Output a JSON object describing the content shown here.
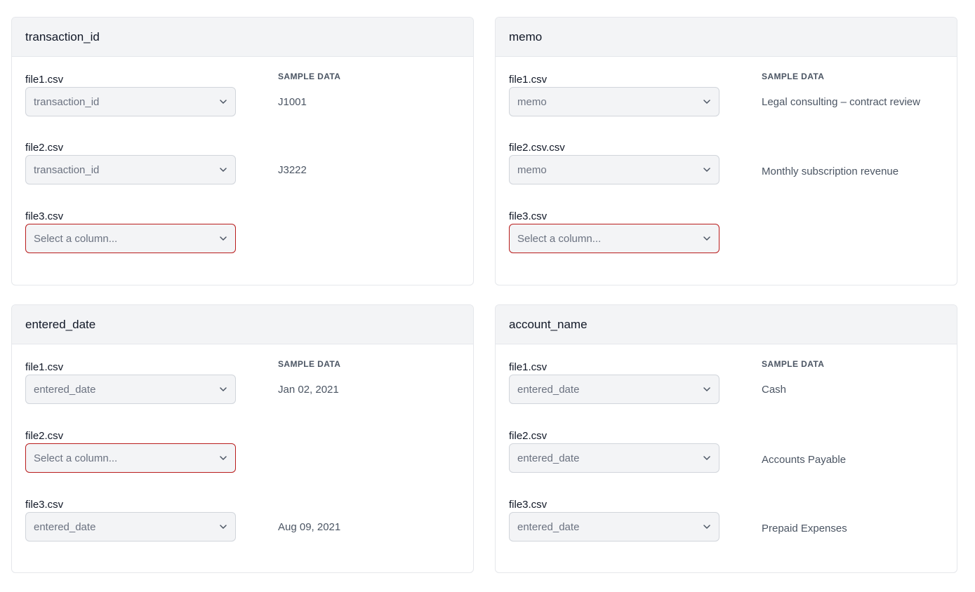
{
  "cards": [
    {
      "title": "transaction_id",
      "sample_header": "SAMPLE DATA",
      "rows": [
        {
          "file": "file1.csv",
          "selected": "transaction_id",
          "sample": "J1001"
        },
        {
          "file": "file2.csv",
          "selected": "transaction_id",
          "sample": "J3222"
        },
        {
          "file": "file3.csv",
          "selected": "Select a column...",
          "sample": ""
        }
      ]
    },
    {
      "title": "memo",
      "sample_header": "SAMPLE DATA",
      "rows": [
        {
          "file": "file1.csv",
          "selected": "memo",
          "sample": "Legal consulting – contract review"
        },
        {
          "file": "file2.csv.csv",
          "selected": "memo",
          "sample": "Monthly subscription revenue"
        },
        {
          "file": "file3.csv",
          "selected": "Select a column...",
          "sample": ""
        }
      ]
    },
    {
      "title": "entered_date",
      "sample_header": "SAMPLE DATA",
      "rows": [
        {
          "file": "file1.csv",
          "selected": "entered_date",
          "sample": "Jan 02, 2021"
        },
        {
          "file": "file2.csv",
          "selected": "Select a column...",
          "sample": ""
        },
        {
          "file": "file3.csv",
          "selected": "entered_date",
          "sample": "Aug 09, 2021"
        }
      ]
    },
    {
      "title": "account_name",
      "sample_header": "SAMPLE DATA",
      "rows": [
        {
          "file": "file1.csv",
          "selected": "entered_date",
          "sample": "Cash"
        },
        {
          "file": "file2.csv",
          "selected": "entered_date",
          "sample": "Accounts Payable"
        },
        {
          "file": "file3.csv",
          "selected": "entered_date",
          "sample": "Prepaid Expenses"
        }
      ]
    }
  ],
  "icons": {
    "dropdown": "chevron-down-icon"
  },
  "colors": {
    "error_border": "#b91c1c",
    "header_bg": "#f3f4f6",
    "select_bg": "#f3f4f6"
  }
}
